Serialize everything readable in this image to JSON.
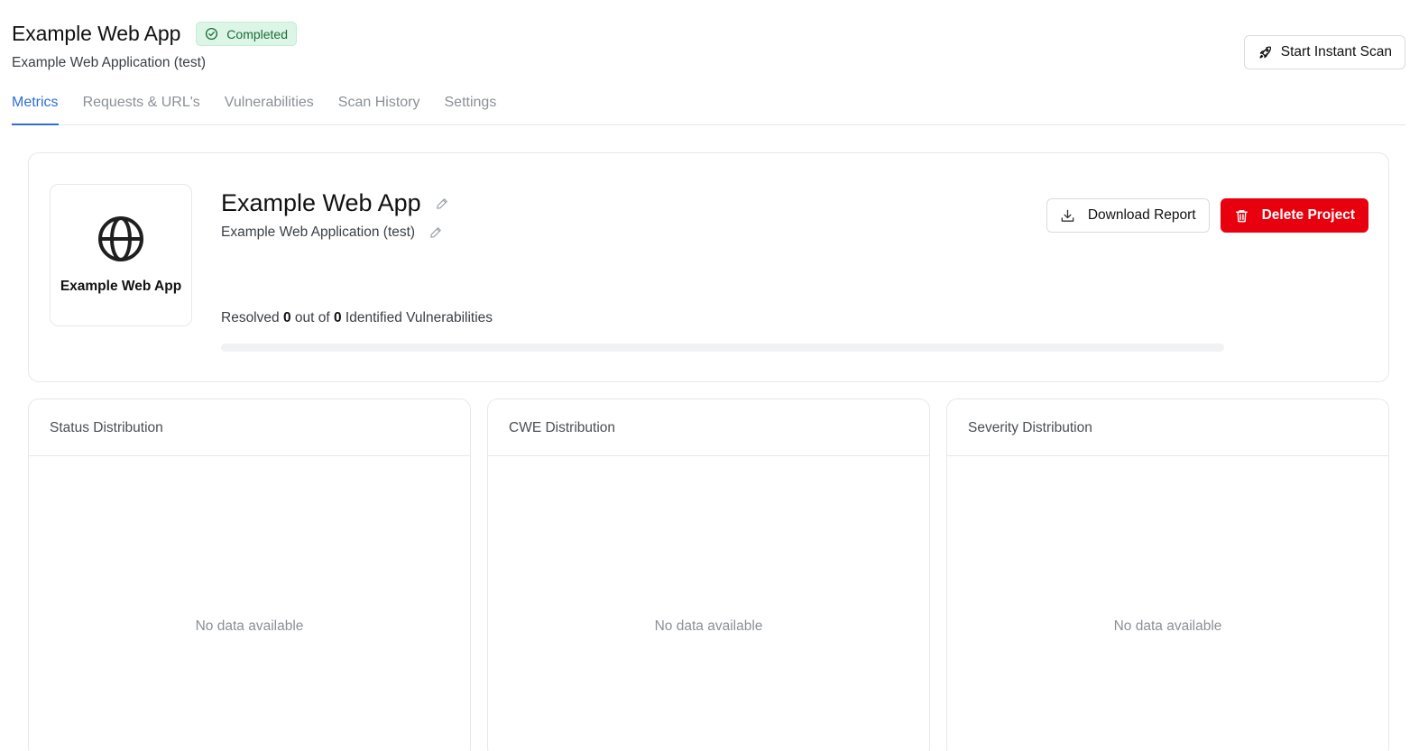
{
  "header": {
    "title": "Example Web App",
    "status_badge": "Completed",
    "subtitle": "Example Web Application (test)",
    "scan_button": "Start Instant Scan"
  },
  "tabs": [
    {
      "label": "Metrics",
      "active": true
    },
    {
      "label": "Requests & URL's",
      "active": false
    },
    {
      "label": "Vulnerabilities",
      "active": false
    },
    {
      "label": "Scan History",
      "active": false
    },
    {
      "label": "Settings",
      "active": false
    }
  ],
  "project": {
    "logo_label": "Example Web App",
    "logo_icon": "globe-icon",
    "name": "Example Web App",
    "description": "Example Web Application (test)",
    "resolved_prefix": "Resolved",
    "resolved_count": "0",
    "resolved_mid": "out of",
    "identified_count": "0",
    "resolved_suffix": "Identified Vulnerabilities",
    "progress_fraction": 0,
    "download_button": "Download Report",
    "delete_button": "Delete Project"
  },
  "distributions": [
    {
      "title": "Status Distribution",
      "empty": "No data available"
    },
    {
      "title": "CWE Distribution",
      "empty": "No data available"
    },
    {
      "title": "Severity Distribution",
      "empty": "No data available"
    }
  ],
  "colors": {
    "accent": "#2d6fd8",
    "danger": "#e8000f",
    "success_bg": "#dcf5e6",
    "success_text": "#1b6b3a"
  }
}
